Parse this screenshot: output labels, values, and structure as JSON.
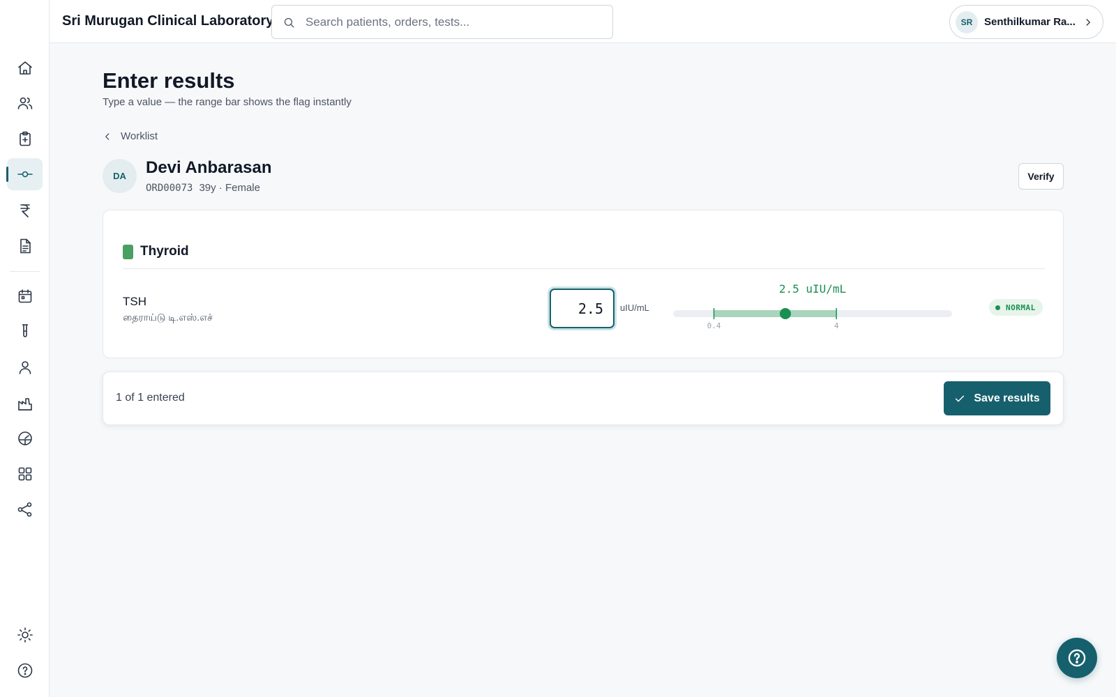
{
  "app": {
    "lab_name": "Sri Murugan Clinical Laboratory",
    "accent_color": "#16606d"
  },
  "search": {
    "placeholder": "Search patients, orders, tests..."
  },
  "user": {
    "initials": "SR",
    "name": "Senthilkumar Ra..."
  },
  "sidebar": {
    "items": [
      {
        "icon": "home-icon",
        "active": false
      },
      {
        "icon": "users-icon",
        "active": false
      },
      {
        "icon": "clipboard-plus-icon",
        "active": false
      },
      {
        "icon": "results-slider-icon",
        "active": true
      },
      {
        "icon": "rupee-icon",
        "active": false
      },
      {
        "icon": "document-icon",
        "active": false
      },
      {
        "icon": "calendar-icon",
        "active": false
      },
      {
        "icon": "test-tube-icon",
        "active": false
      },
      {
        "icon": "person-icon",
        "active": false
      },
      {
        "icon": "factory-icon",
        "active": false
      },
      {
        "icon": "gauge-icon",
        "active": false
      },
      {
        "icon": "grid-icon",
        "active": false
      },
      {
        "icon": "share-icon",
        "active": false
      },
      {
        "icon": "sun-icon",
        "active": false
      },
      {
        "icon": "help-circle-icon",
        "active": false
      }
    ]
  },
  "page": {
    "title": "Enter results",
    "subtitle": "Type a value — the range bar shows the flag instantly",
    "back_label": "Worklist"
  },
  "patient": {
    "initials": "DA",
    "name": "Devi Anbarasan",
    "order_id": "ORD00073",
    "demographics": "39y · Female"
  },
  "actions": {
    "verify_label": "Verify",
    "save_label": "Save results"
  },
  "section": {
    "name": "Thyroid",
    "color": "#4a9f63"
  },
  "test": {
    "name": "TSH",
    "local_name": "தைராய்டு டி.எஸ்.எச்",
    "value": "2.5",
    "unit": "uIU/mL",
    "readout": "2.5 uIU/mL",
    "range_low": 0.4,
    "range_high": 4,
    "range_low_label": "0.4",
    "range_high_label": "4",
    "scale_min": -0.8,
    "scale_max": 7.4,
    "flag": "NORMAL",
    "normal_color": "#1a8f52",
    "band_color": "#a8d5bb",
    "track_color": "#eceef3"
  },
  "footer": {
    "entered_text": "1 of 1 entered"
  }
}
